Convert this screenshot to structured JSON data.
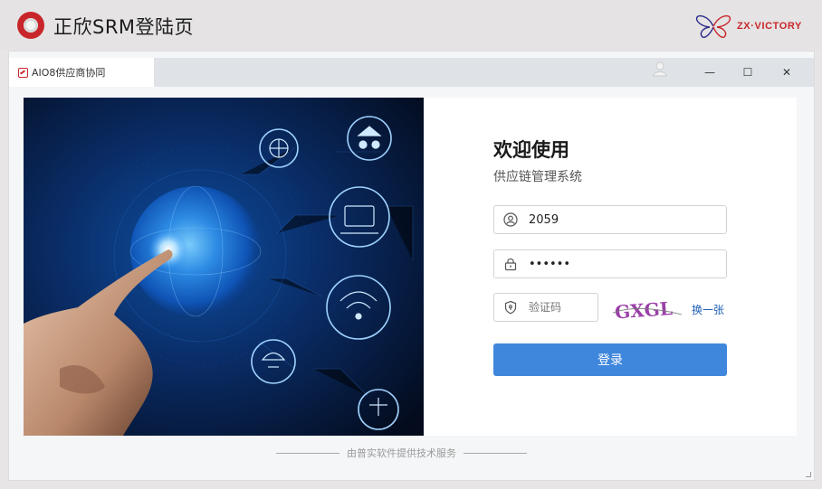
{
  "header": {
    "title": "正欣SRM登陆页",
    "brand_text": "ZX·VICTORY",
    "brand_color": "#c8262b"
  },
  "window": {
    "tab_label": "AIO8供应商协同",
    "controls": {
      "minimize": "—",
      "maximize": "☐",
      "close": "✕"
    }
  },
  "login": {
    "welcome": "欢迎使用",
    "subtitle": "供应链管理系统",
    "username_value": "2059",
    "password_value": "••••••",
    "captcha_placeholder": "验证码",
    "captcha_text": "GXGL",
    "refresh_label": "换一张",
    "submit_label": "登录",
    "accent_color": "#3f87dd"
  },
  "footer": {
    "text": "由普实软件提供技术服务"
  }
}
